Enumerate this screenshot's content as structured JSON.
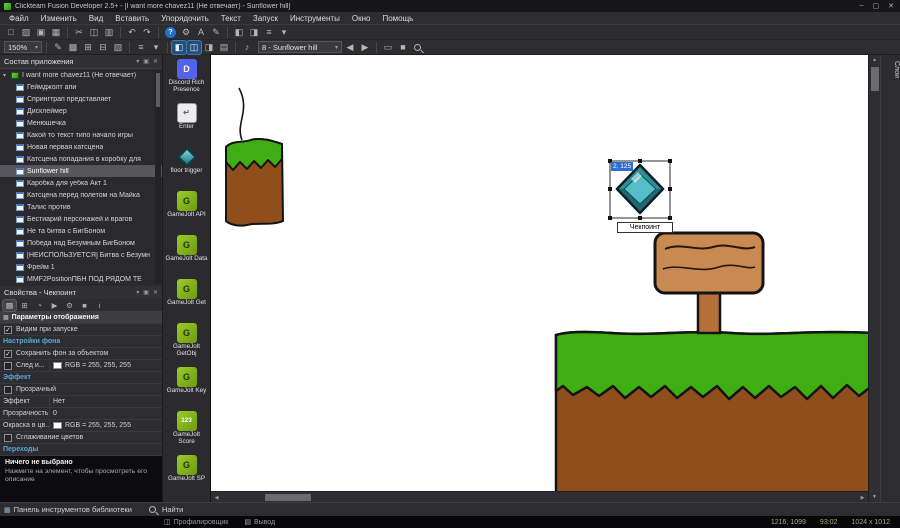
{
  "window": {
    "title": "Clickteam Fusion Developer 2.5+ - [I want more chavez11 (Не отвечает) - Sunflower hill]",
    "minimize": "–",
    "maximize": "▢",
    "close": "✕"
  },
  "menu": {
    "items": [
      "Файл",
      "Изменить",
      "Вид",
      "Вставить",
      "Упорядочить",
      "Текст",
      "Запуск",
      "Инструменты",
      "Окно",
      "Помощь"
    ]
  },
  "icons": {
    "new": "□",
    "open": "▨",
    "save": "▣",
    "saveall": "▦",
    "cut": "✂",
    "copy": "◫",
    "paste": "▥",
    "undo": "↶",
    "redo": "↷",
    "help": "?",
    "settings": "⚙",
    "text": "A",
    "edit": "✎",
    "viewl": "◧",
    "viewr": "◨",
    "list": "≡",
    "drop": "▾",
    "grid": "⊞",
    "gridoff": "⊟",
    "shade": "▩",
    "hatch": "▧",
    "note": "♪",
    "prev": "◀",
    "next": "▶",
    "rect": "▭",
    "sq": "■",
    "up": "▲",
    "down": "▼",
    "left": "◀",
    "right": "▶",
    "pin": "▣",
    "close": "✕",
    "panel": "▦",
    "window": "◫",
    "output": "▤",
    "info": "i",
    "play": "▶",
    "circle": "◔"
  },
  "toolbar": {
    "zoom_value": "150%",
    "frame_selector": "8 - Sunflower hill"
  },
  "workspace": {
    "title": "Состав приложения",
    "items": [
      {
        "label": "I want more chavez11 (Не отвечает)",
        "type": "application"
      },
      {
        "label": "Геймджолт апи",
        "type": "frame"
      },
      {
        "label": "Спрингтрап представляет",
        "type": "frame"
      },
      {
        "label": "Дисклеймер",
        "type": "frame"
      },
      {
        "label": "Менюшечка",
        "type": "frame"
      },
      {
        "label": "Какой то текст типо начало игры",
        "type": "frame"
      },
      {
        "label": "Новая первая катсцена",
        "type": "frame"
      },
      {
        "label": "Катсцена попадания в коробку для",
        "type": "frame"
      },
      {
        "label": "Sunflower hill",
        "type": "frame",
        "selected": true
      },
      {
        "label": "Каробка для уебка Акт 1",
        "type": "frame"
      },
      {
        "label": "Катсцена перед полетом на Майка",
        "type": "frame"
      },
      {
        "label": "Талис против",
        "type": "frame"
      },
      {
        "label": "Бестиарий персонажей и врагов",
        "type": "frame"
      },
      {
        "label": "Не та битва с БигБоном",
        "type": "frame"
      },
      {
        "label": "Победа над Безумным БигБоном",
        "type": "frame"
      },
      {
        "label": "[НЕИСПОЛЬЗУЕТСЯ] Битва с Безумн",
        "type": "frame"
      },
      {
        "label": "Фрейм 1",
        "type": "frame"
      },
      {
        "label": "MMF2PositionПБН ПОД РЯДОМ ТЕ",
        "type": "frame"
      }
    ]
  },
  "library": {
    "items": [
      {
        "label": "Discord Rich Presence"
      },
      {
        "label": "Enter"
      },
      {
        "label": "floor trigger"
      },
      {
        "label": "GameJolt API"
      },
      {
        "label": "GameJolt Data"
      },
      {
        "label": "GameJolt Get"
      },
      {
        "label": "GameJolt GetObj"
      },
      {
        "label": "GameJolt Key"
      },
      {
        "label": "GameJolt Score",
        "badge": "123"
      },
      {
        "label": "GameJolt SP"
      }
    ]
  },
  "properties": {
    "title": "Свойства - Чекпоинт",
    "rows": [
      {
        "kind": "section",
        "label": "Параметры отображения"
      },
      {
        "kind": "check",
        "label": "Видим при запуске",
        "checked": true
      },
      {
        "kind": "link",
        "label": "Настройки фона"
      },
      {
        "kind": "check",
        "label": "Сохранить фон за объектом",
        "checked": true
      },
      {
        "kind": "color",
        "label": "След и...",
        "value": "RGB = 255, 255, 255"
      },
      {
        "kind": "link",
        "label": "Эффект"
      },
      {
        "kind": "check",
        "label": "Прозрачный",
        "checked": false
      },
      {
        "kind": "value",
        "label": "Эффект",
        "value": "Нет"
      },
      {
        "kind": "value",
        "label": "Прозрачность",
        "value": "0"
      },
      {
        "kind": "color",
        "label": "Окраска в цв...",
        "value": "RGB = 255, 255, 255"
      },
      {
        "kind": "check",
        "label": "Сглаживание цветов",
        "checked": false
      },
      {
        "kind": "link",
        "label": "Переходы"
      }
    ],
    "description": {
      "title": "Ничего не выбрано",
      "text": "Нажмите на элемент, чтобы просмотреть его описание"
    }
  },
  "canvas": {
    "selection": {
      "coords_label": "2, 125",
      "object_label": "Чекпоинт"
    },
    "layers_tab": "Слои"
  },
  "statusbar": {
    "library_tab": "Панель инструментов библиотеки",
    "find_tab": "Найти",
    "profiler_tab": "Профилировщик",
    "output_tab": "Вывод",
    "right": {
      "pos": "1216, 1099",
      "time": "93:02",
      "size": "1024 x 1012"
    }
  }
}
